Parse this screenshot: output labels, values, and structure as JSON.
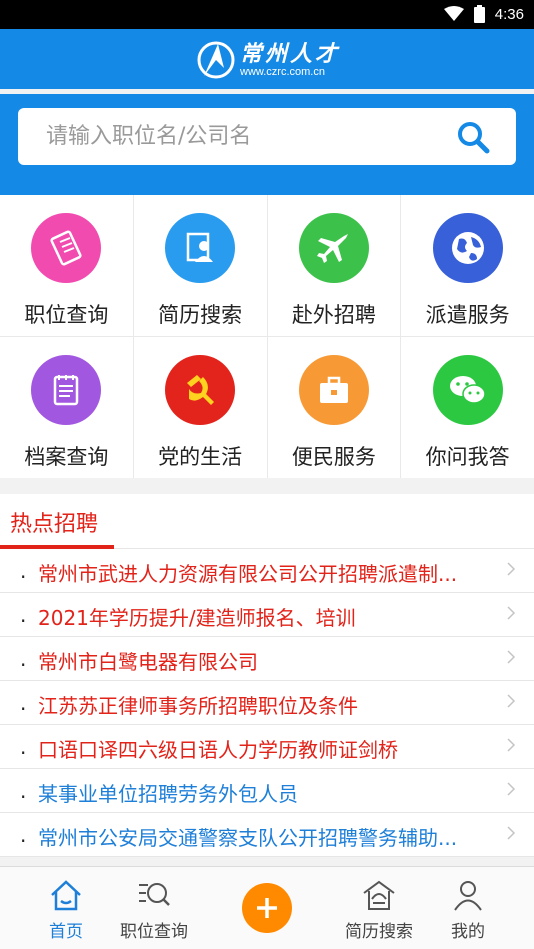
{
  "status_bar": {
    "time": "4:36"
  },
  "header": {
    "brand": "常州人才",
    "url": "www.czrc.com.cn"
  },
  "search": {
    "placeholder": "请输入职位名/公司名"
  },
  "grid": [
    {
      "label": "职位查询",
      "icon": "job-query-icon",
      "color": "#f24bb0"
    },
    {
      "label": "简历搜索",
      "icon": "resume-search-icon",
      "color": "#2a9cef"
    },
    {
      "label": "赴外招聘",
      "icon": "airplane-icon",
      "color": "#3cc14a"
    },
    {
      "label": "派遣服务",
      "icon": "globe-icon",
      "color": "#3860d8"
    },
    {
      "label": "档案查询",
      "icon": "archive-icon",
      "color": "#a257e0"
    },
    {
      "label": "党的生活",
      "icon": "party-emblem-icon",
      "color": "#e3241d"
    },
    {
      "label": "便民服务",
      "icon": "toolbox-icon",
      "color": "#f79a36"
    },
    {
      "label": "你问我答",
      "icon": "wechat-icon",
      "color": "#2dc842"
    }
  ],
  "hot": {
    "title": "热点招聘",
    "items": [
      {
        "text": "常州市武进人力资源有限公司公开招聘派遣制...",
        "color": "#e2231a"
      },
      {
        "text": "2021年学历提升/建造师报名、培训",
        "color": "#e2231a"
      },
      {
        "text": "常州市白鹭电器有限公司",
        "color": "#e2231a"
      },
      {
        "text": "江苏苏正律师事务所招聘职位及条件",
        "color": "#e2231a"
      },
      {
        "text": "口语口译四六级日语人力学历教师证剑桥",
        "color": "#e2231a"
      },
      {
        "text": "某事业单位招聘劳务外包人员",
        "color": "#1e7fd8"
      },
      {
        "text": "常州市公安局交通警察支队公开招聘警务辅助...",
        "color": "#1e7fd8"
      }
    ]
  },
  "tabs": [
    {
      "label": "首页",
      "icon": "home-icon",
      "active": true
    },
    {
      "label": "职位查询",
      "icon": "job-search-icon",
      "active": false
    },
    {
      "label": "简历搜索",
      "icon": "resume-icon",
      "active": false
    },
    {
      "label": "我的",
      "icon": "profile-icon",
      "active": false
    }
  ],
  "colors": {
    "primary": "#1589e6",
    "accent": "#ff8a00",
    "hot": "#e2231a"
  }
}
